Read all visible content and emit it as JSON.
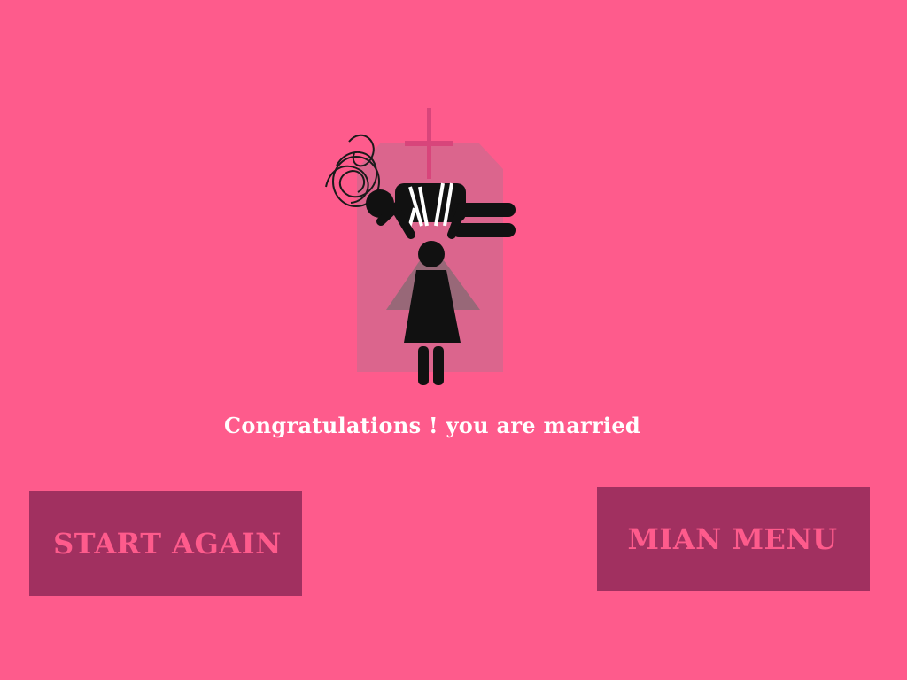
{
  "scene": {
    "background_color": "#fe5b8c",
    "illustration": "bride carrying groom in front of church"
  },
  "message": "Congratulations ! you are married",
  "buttons": {
    "start_again": "START AGAIN",
    "main_menu": "MIAN MENU"
  },
  "colors": {
    "button_bg": "#a13060",
    "button_text": "#fe5b8c",
    "message_text": "#ffffff"
  }
}
